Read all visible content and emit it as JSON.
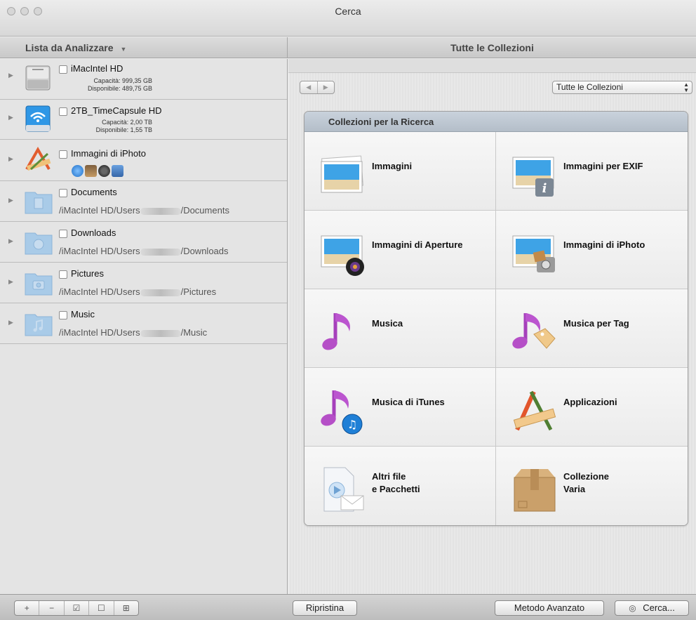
{
  "window": {
    "title": "Cerca"
  },
  "header": {
    "left_title": "Lista da Analizzare",
    "right_title": "Tutte le Collezioni"
  },
  "sources": [
    {
      "name": "iMacIntel HD",
      "capacity": "Capacità: 999,35 GB",
      "available": "Disponibile: 489,75 GB",
      "icon": "hard-drive-icon"
    },
    {
      "name": "2TB_TimeCapsule HD",
      "capacity": "Capacità: 2,00 TB",
      "available": "Disponibile: 1,55 TB",
      "icon": "wifi-drive-icon"
    },
    {
      "name": "Immagini di iPhoto",
      "icon": "applications-icon"
    },
    {
      "name": "Documents",
      "path_prefix": "/iMacIntel HD/Users",
      "path_suffix": "/Documents",
      "icon": "documents-folder-icon"
    },
    {
      "name": "Downloads",
      "path_prefix": "/iMacIntel HD/Users",
      "path_suffix": "/Downloads",
      "icon": "downloads-folder-icon"
    },
    {
      "name": "Pictures",
      "path_prefix": "/iMacIntel HD/Users",
      "path_suffix": "/Pictures",
      "icon": "pictures-folder-icon"
    },
    {
      "name": "Music",
      "path_prefix": "/iMacIntel HD/Users",
      "path_suffix": "/Music",
      "icon": "music-folder-icon"
    }
  ],
  "selector": {
    "value": "Tutte le Collezioni"
  },
  "collections": {
    "title": "Collezioni per la Ricerca",
    "items": [
      {
        "label": "Immagini",
        "icon": "images-icon"
      },
      {
        "label": "Immagini per EXIF",
        "icon": "images-exif-icon"
      },
      {
        "label": "Immagini di Aperture",
        "icon": "aperture-images-icon"
      },
      {
        "label": "Immagini di iPhoto",
        "icon": "iphoto-images-icon"
      },
      {
        "label": "Musica",
        "icon": "music-note-icon"
      },
      {
        "label": "Musica per Tag",
        "icon": "music-tag-icon"
      },
      {
        "label": "Musica di iTunes",
        "icon": "itunes-music-icon"
      },
      {
        "label": "Applicazioni",
        "icon": "applications-icon"
      },
      {
        "label_line1": "Altri file",
        "label_line2": "e Pacchetti",
        "icon": "other-files-icon"
      },
      {
        "label_line1": "Collezione",
        "label_line2": "Varia",
        "icon": "box-icon"
      }
    ]
  },
  "bottom": {
    "add": "+",
    "remove": "−",
    "check": "☑",
    "uncheck": "☐",
    "folder": "⊞",
    "reset": "Ripristina",
    "advanced": "Metodo Avanzato",
    "search": "Cerca..."
  },
  "colors": {
    "accent_purple": "#b54fc7",
    "collection_header": "#bcc6d1"
  }
}
